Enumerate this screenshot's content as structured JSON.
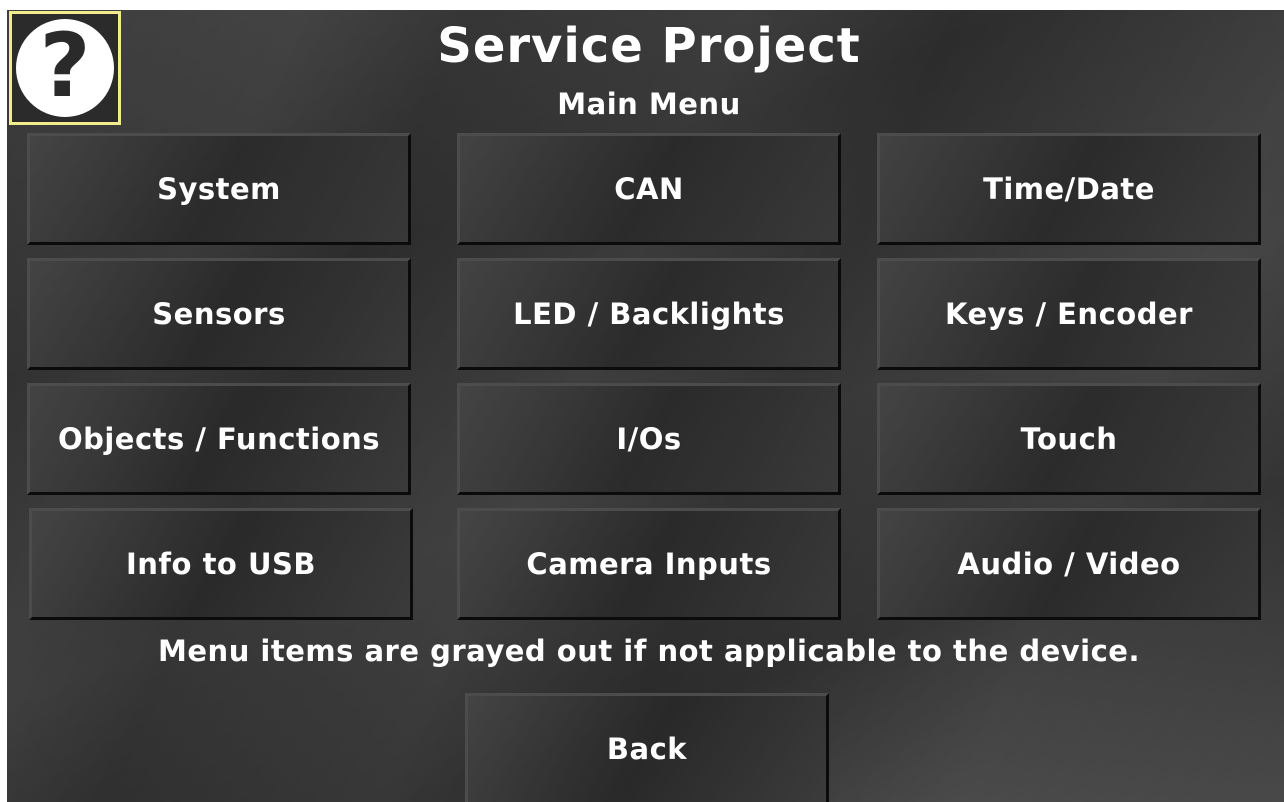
{
  "header": {
    "title": "Service Project",
    "subtitle": "Main Menu"
  },
  "help_button": {
    "icon": "question-mark-icon",
    "symbol": "?"
  },
  "menu": {
    "system": "System",
    "can": "CAN",
    "time_date": "Time/Date",
    "sensors": "Sensors",
    "led_backlights": "LED / Backlights",
    "keys_encoder": "Keys / Encoder",
    "objects_functions": "Objects / Functions",
    "ios": "I/Os",
    "touch": "Touch",
    "info_to_usb": "Info to USB",
    "camera_inputs": "Camera Inputs",
    "audio_video": "Audio / Video"
  },
  "note": "Menu items are grayed out if not applicable to the device.",
  "back_button": "Back",
  "colors": {
    "help_border": "#f2ec8a",
    "text": "#ffffff",
    "background": "#333333"
  }
}
